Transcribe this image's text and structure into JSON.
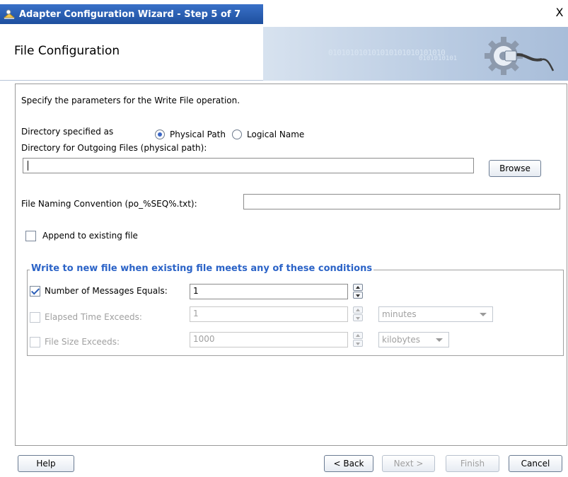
{
  "window": {
    "title": "Adapter Configuration Wizard - Step 5 of 7",
    "close_label": "X"
  },
  "header": {
    "title": "File Configuration",
    "banner_binary": "010101010101010101010101010",
    "banner_binary2": "0101010101"
  },
  "main": {
    "intro": "Specify the parameters for the Write File operation.",
    "directory_specified_label": "Directory specified as",
    "radio_physical_label": "Physical Path",
    "radio_logical_label": "Logical Name",
    "selected_radio": "Physical Path",
    "outgoing_dir_label": "Directory for Outgoing Files (physical path):",
    "outgoing_dir_value": "",
    "browse_label": "Browse",
    "naming_label": "File Naming Convention (po_%SEQ%.txt):",
    "naming_value": "",
    "append_label": "Append to existing file",
    "append_checked": false
  },
  "group": {
    "title": "Write to new file when existing file meets any of these conditions",
    "rows": [
      {
        "label": "Number of Messages Equals:",
        "value": "1",
        "checked": true,
        "enabled": true
      },
      {
        "label": "Elapsed Time Exceeds:",
        "value": "1",
        "checked": false,
        "enabled": false,
        "unit": "minutes"
      },
      {
        "label": "File Size Exceeds:",
        "value": "1000",
        "checked": false,
        "enabled": false,
        "unit": "kilobytes"
      }
    ]
  },
  "footer": {
    "help": "Help",
    "back": "< Back",
    "next": "Next >",
    "finish": "Finish",
    "cancel": "Cancel"
  },
  "colors": {
    "title_bar": "#2d62b8",
    "group_title": "#2b63c7",
    "checkmark": "#2c5fb8"
  }
}
